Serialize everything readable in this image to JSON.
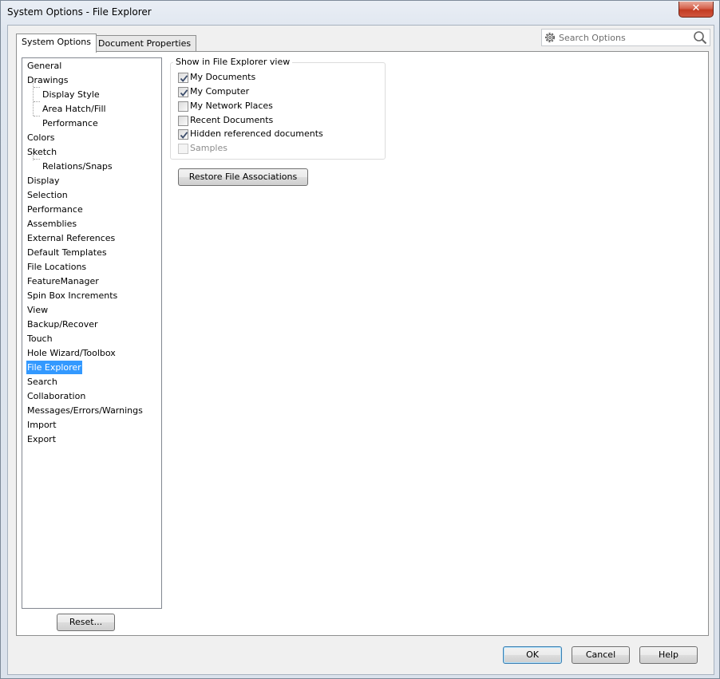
{
  "window": {
    "title": "System Options - File Explorer",
    "close_label": "✕"
  },
  "tabs": [
    {
      "label": "System Options",
      "active": true
    },
    {
      "label": "Document Properties",
      "active": false
    }
  ],
  "search": {
    "placeholder": "Search Options"
  },
  "tree": {
    "items": [
      {
        "label": "General",
        "level": 0
      },
      {
        "label": "Drawings",
        "level": 0
      },
      {
        "label": "Display Style",
        "level": 1
      },
      {
        "label": "Area Hatch/Fill",
        "level": 1
      },
      {
        "label": "Performance",
        "level": 1
      },
      {
        "label": "Colors",
        "level": 0
      },
      {
        "label": "Sketch",
        "level": 0
      },
      {
        "label": "Relations/Snaps",
        "level": 1
      },
      {
        "label": "Display",
        "level": 0
      },
      {
        "label": "Selection",
        "level": 0
      },
      {
        "label": "Performance",
        "level": 0
      },
      {
        "label": "Assemblies",
        "level": 0
      },
      {
        "label": "External References",
        "level": 0
      },
      {
        "label": "Default Templates",
        "level": 0
      },
      {
        "label": "File Locations",
        "level": 0
      },
      {
        "label": "FeatureManager",
        "level": 0
      },
      {
        "label": "Spin Box Increments",
        "level": 0
      },
      {
        "label": "View",
        "level": 0
      },
      {
        "label": "Backup/Recover",
        "level": 0
      },
      {
        "label": "Touch",
        "level": 0
      },
      {
        "label": "Hole Wizard/Toolbox",
        "level": 0
      },
      {
        "label": "File Explorer",
        "level": 0,
        "selected": true
      },
      {
        "label": "Search",
        "level": 0
      },
      {
        "label": "Collaboration",
        "level": 0
      },
      {
        "label": "Messages/Errors/Warnings",
        "level": 0
      },
      {
        "label": "Import",
        "level": 0
      },
      {
        "label": "Export",
        "level": 0
      }
    ],
    "reset_label": "Reset..."
  },
  "group": {
    "title": "Show in File Explorer view",
    "options": [
      {
        "label": "My Documents",
        "checked": true,
        "disabled": false
      },
      {
        "label": "My Computer",
        "checked": true,
        "disabled": false
      },
      {
        "label": "My Network Places",
        "checked": false,
        "disabled": false
      },
      {
        "label": "Recent Documents",
        "checked": false,
        "disabled": false
      },
      {
        "label": "Hidden referenced documents",
        "checked": true,
        "disabled": false
      },
      {
        "label": "Samples",
        "checked": false,
        "disabled": true
      }
    ]
  },
  "restore_label": "Restore File Associations",
  "footer": {
    "ok_label": "OK",
    "cancel_label": "Cancel",
    "help_label": "Help"
  }
}
